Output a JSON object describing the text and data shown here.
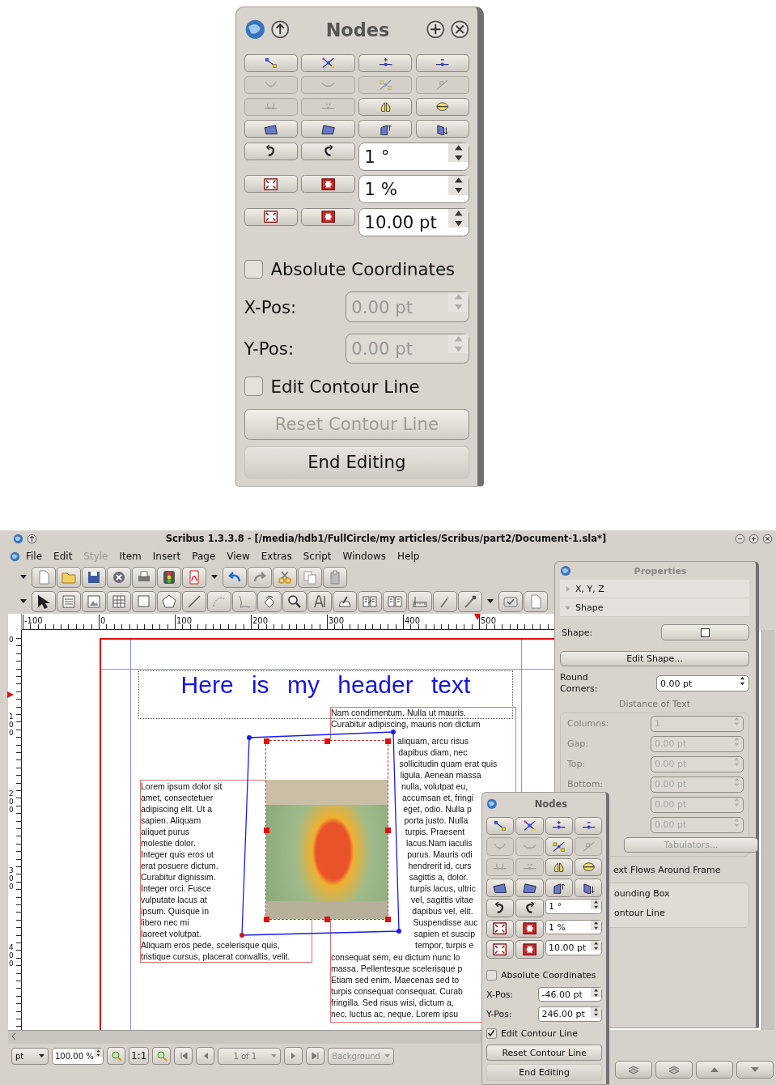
{
  "enlarged_nodes_panel": {
    "title": "Nodes",
    "window_buttons": true,
    "tools": [
      {
        "disabled": false
      },
      {
        "disabled": false
      },
      {
        "disabled": false
      },
      {
        "disabled": false
      },
      {
        "disabled": true
      },
      {
        "disabled": true
      },
      {
        "disabled": true
      },
      {
        "disabled": true
      },
      {
        "disabled": true
      },
      {
        "disabled": true
      },
      {
        "disabled": false
      },
      {
        "disabled": false
      },
      {
        "disabled": false
      },
      {
        "disabled": false
      },
      {
        "disabled": false
      },
      {
        "disabled": false
      }
    ],
    "rotate": "1 °",
    "scale_percent": "1 %",
    "scale_size": "10.00 pt",
    "absolute_coordinates": {
      "label": "Absolute Coordinates",
      "checked": false
    },
    "x_pos": {
      "label": "X-Pos:",
      "value": "0.00 pt",
      "disabled": true
    },
    "y_pos": {
      "label": "Y-Pos:",
      "value": "0.00 pt",
      "disabled": true
    },
    "edit_contour": {
      "label": "Edit Contour Line",
      "checked": false
    },
    "reset_button": {
      "label": "Reset Contour Line",
      "disabled": true
    },
    "end_button": {
      "label": "End Editing"
    }
  },
  "window": {
    "title": "Scribus 1.3.3.8 - [/media/hdb1/FullCircle/my articles/Scribus/part2/Document-1.sla*]",
    "menu": [
      {
        "label": "File",
        "disabled": false
      },
      {
        "label": "Edit",
        "disabled": false
      },
      {
        "label": "Style",
        "disabled": true
      },
      {
        "label": "Item",
        "disabled": false
      },
      {
        "label": "Insert",
        "disabled": false
      },
      {
        "label": "Page",
        "disabled": false
      },
      {
        "label": "View",
        "disabled": false
      },
      {
        "label": "Extras",
        "disabled": false
      },
      {
        "label": "Script",
        "disabled": false
      },
      {
        "label": "Windows",
        "disabled": false
      },
      {
        "label": "Help",
        "disabled": false
      }
    ],
    "ruler": {
      "labels": [
        "-100",
        "0",
        "100",
        "200",
        "300",
        "400",
        "500"
      ]
    },
    "vertical_ruler": {
      "labels": [
        "0",
        "100",
        "200",
        "300",
        "400"
      ]
    },
    "document": {
      "header": "Here is my header text",
      "left_text": {
        "wrapped_lines": [
          "Lorem ipsum dolor sit",
          "amet, consectetuer",
          "adipiscing elit. Ut a",
          "sapien. Aliquam",
          "aliquet purus",
          "molestie dolor.",
          "Integer quis eros ut",
          "erat posuere dictum.",
          "Curabitur dignissim.",
          "Integer orci. Fusce",
          "vulputate lacus at",
          "ipsum. Quisque in",
          "libero nec mi",
          "laoreet volutpat."
        ],
        "full_lines": [
          "Aliquam eros pede, scelerisque quis,",
          "tristique cursus, placerat convallis, velit."
        ]
      },
      "right_text": {
        "upper_lines": [
          "Nam condimentum. Nulla ut mauris.",
          "Curabitur adipiscing, mauris non dictum",
          "aliquam, arcu risus",
          "dapibus diam, nec",
          "sollicitudin quam erat quis",
          "ligula. Aenean massa",
          "nulla, volutpat eu,"
        ],
        "middle_lines": [
          "accumsan et, fringi",
          "eget, odio. Nulla p",
          "porta justo. Nulla",
          "turpis. Praesent",
          "lacus.Nam iaculis",
          "purus. Mauris odi",
          "hendrerit id, curs",
          "sagittis a, dolor.",
          "turpis lacus, ultric",
          "vel, sagittis vitae",
          "dapibus vel, elit.",
          "Suspendisse auc",
          "sapien et suscip",
          "tempor, turpis e"
        ],
        "lower_lines": [
          "consequat sem, eu dictum nunc lo",
          "massa. Pellentesque scelerisque p",
          "Etiam sed enim. Maecenas sed to",
          "turpis consequat consequat. Curab",
          "fringilla. Sed risus wisi, dictum a,",
          "nec, luctus ac, neque. Lorem ipsu"
        ]
      },
      "contour_nodes": [
        {
          "selected": false
        },
        {
          "selected": false
        },
        {
          "selected": false
        },
        {
          "selected": true
        }
      ]
    },
    "properties": {
      "title": "Properties",
      "sections": [
        {
          "label": "X, Y, Z",
          "expanded": false
        },
        {
          "label": "Shape",
          "expanded": true
        }
      ],
      "shape_label": "Shape:",
      "edit_shape_button": "Edit Shape...",
      "round_corners": {
        "label": "Round Corners:",
        "value": "0.00 pt"
      },
      "distance_title": "Distance of Text",
      "distance_fields": [
        {
          "label": "Columns:",
          "value": "1",
          "disabled": true
        },
        {
          "label": "Gap:",
          "value": "0.00 pt",
          "disabled": true
        },
        {
          "label": "Top:",
          "value": "0.00 pt",
          "disabled": true
        },
        {
          "label": "Bottom:",
          "value": "0.00 pt",
          "disabled": true
        },
        {
          "value": "0.00 pt",
          "disabled": true
        },
        {
          "value": "0.00 pt",
          "disabled": true
        }
      ],
      "tabulators_button": {
        "label": "Tabulators...",
        "disabled": true
      },
      "text_flow_title": "ext Flows Around Frame",
      "text_flow_options": [
        "ounding Box",
        "ontour Line"
      ]
    },
    "nodes_palette": {
      "title": "Nodes",
      "window_buttons": false,
      "tools": [
        {
          "disabled": false
        },
        {
          "disabled": false
        },
        {
          "disabled": false
        },
        {
          "disabled": false
        },
        {
          "disabled": true
        },
        {
          "disabled": true
        },
        {
          "disabled": false
        },
        {
          "disabled": true
        },
        {
          "disabled": true
        },
        {
          "disabled": true
        },
        {
          "disabled": false
        },
        {
          "disabled": false
        },
        {
          "disabled": false
        },
        {
          "disabled": false
        },
        {
          "disabled": false
        },
        {
          "disabled": false
        }
      ],
      "rotate": "1 °",
      "scale_percent": "1 %",
      "scale_size": "10.00 pt",
      "absolute_coordinates": {
        "label": "Absolute Coordinates",
        "checked": false
      },
      "x_pos": {
        "label": "X-Pos:",
        "value": "-46.00 pt",
        "disabled": false
      },
      "y_pos": {
        "label": "Y-Pos:",
        "value": "246.00 pt",
        "disabled": false
      },
      "edit_contour": {
        "label": "Edit Contour Line",
        "checked": true
      },
      "reset_button": {
        "label": "Reset Contour Line",
        "disabled": false
      },
      "end_button": {
        "label": "End Editing"
      }
    },
    "status_bar": {
      "unit": "pt",
      "zoom": "100.00 %",
      "actual_size": "1:1",
      "page": "1 of 1",
      "layer": "Background"
    }
  }
}
